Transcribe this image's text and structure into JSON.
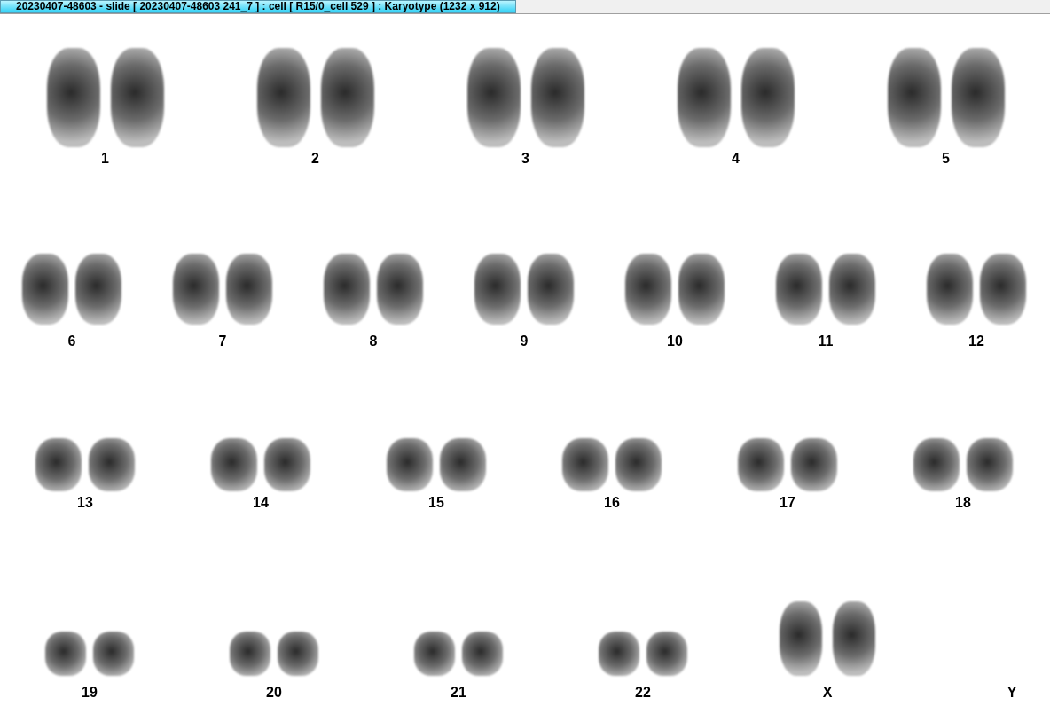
{
  "window": {
    "title": "20230407-48603 - slide [ 20230407-48603 241_7 ] : cell [ R15/0_cell 529 ] : Karyotype  (1232 x 912)"
  },
  "rows": [
    {
      "items": [
        {
          "label": "1",
          "image": true
        },
        {
          "label": "2",
          "image": true
        },
        {
          "label": "3",
          "image": true
        },
        {
          "label": "4",
          "image": true
        },
        {
          "label": "5",
          "image": true
        }
      ]
    },
    {
      "items": [
        {
          "label": "6",
          "image": true
        },
        {
          "label": "7",
          "image": true
        },
        {
          "label": "8",
          "image": true
        },
        {
          "label": "9",
          "image": true
        },
        {
          "label": "10",
          "image": true
        },
        {
          "label": "11",
          "image": true
        },
        {
          "label": "12",
          "image": true
        }
      ]
    },
    {
      "items": [
        {
          "label": "13",
          "image": true
        },
        {
          "label": "14",
          "image": true
        },
        {
          "label": "15",
          "image": true
        },
        {
          "label": "16",
          "image": true
        },
        {
          "label": "17",
          "image": true
        },
        {
          "label": "18",
          "image": true
        }
      ]
    },
    {
      "items": [
        {
          "label": "19",
          "image": true
        },
        {
          "label": "20",
          "image": true
        },
        {
          "label": "21",
          "image": true
        },
        {
          "label": "22",
          "image": true
        },
        {
          "label": "X",
          "image": true
        },
        {
          "label": "Y",
          "image": false
        }
      ]
    }
  ]
}
